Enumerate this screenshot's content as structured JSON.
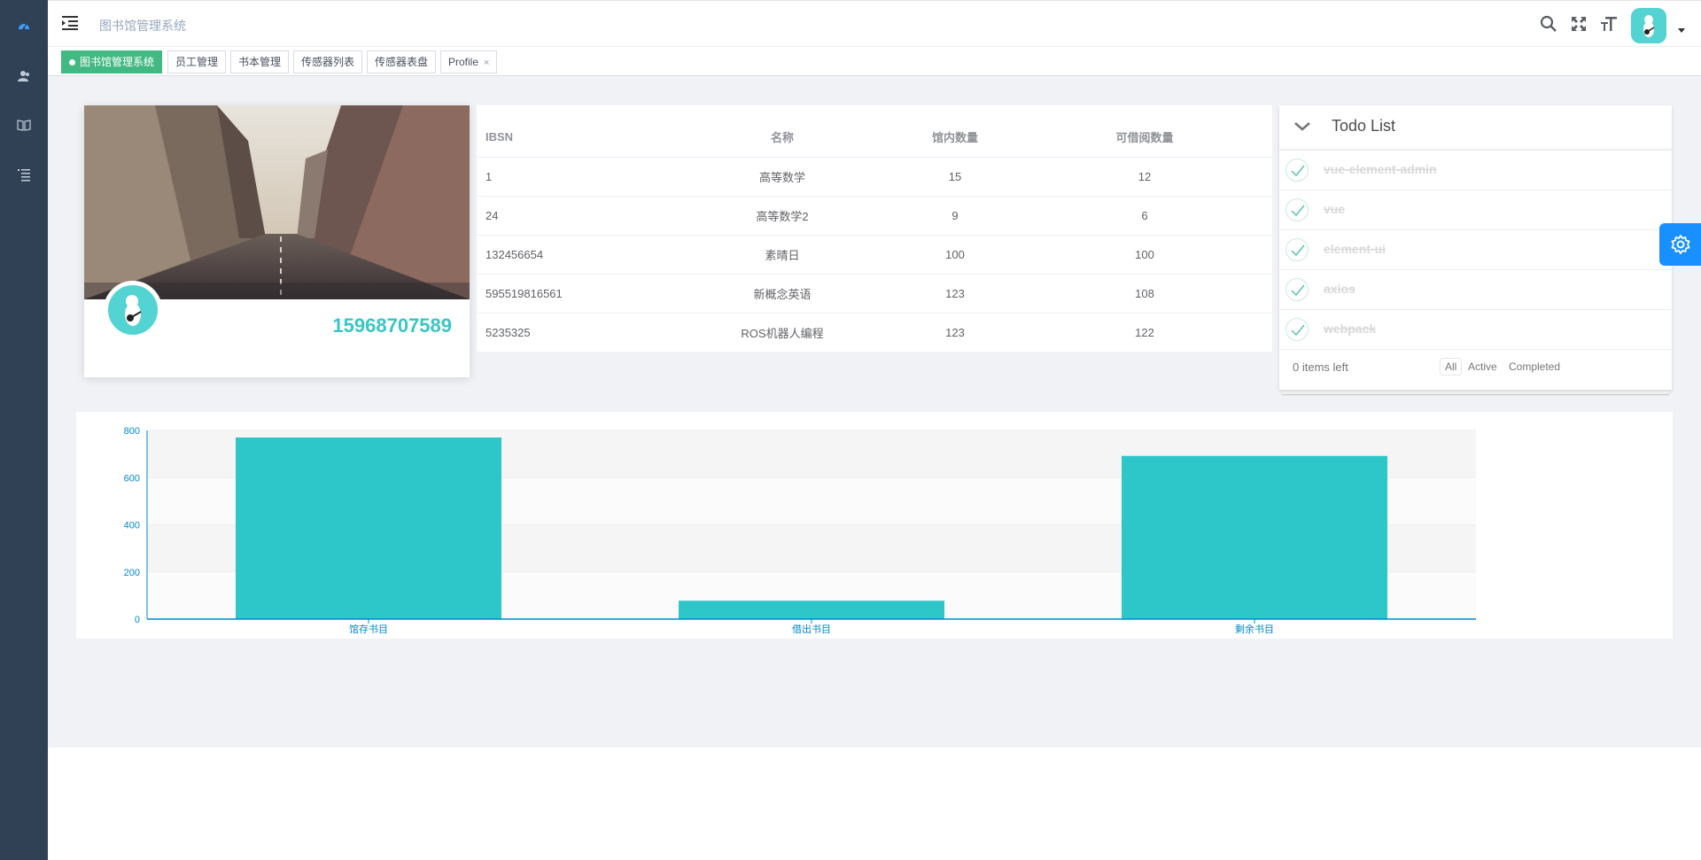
{
  "navbar": {
    "breadcrumb": "图书馆管理系统"
  },
  "tags": [
    {
      "label": "图书馆管理系统",
      "active": true
    },
    {
      "label": "员工管理",
      "active": false
    },
    {
      "label": "书本管理",
      "active": false
    },
    {
      "label": "传感器列表",
      "active": false
    },
    {
      "label": "传感器表盘",
      "active": false
    },
    {
      "label": "Profile",
      "active": false,
      "close": "×"
    }
  ],
  "profile": {
    "phone": "15968707589"
  },
  "book_table": {
    "headers": [
      "IBSN",
      "名称",
      "馆内数量",
      "可借阅数量"
    ],
    "rows": [
      [
        "1",
        "高等数学",
        "15",
        "12"
      ],
      [
        "24",
        "高等数学2",
        "9",
        "6"
      ],
      [
        "132456654",
        "素晴日",
        "100",
        "100"
      ],
      [
        "595519816561",
        "新概念英语",
        "123",
        "108"
      ],
      [
        "5235325",
        "ROS机器人编程",
        "123",
        "122"
      ]
    ]
  },
  "todo": {
    "title": "Todo List",
    "items": [
      "vue-element-admin",
      "vue",
      "element-ui",
      "axios",
      "webpack"
    ],
    "items_left": "0 items left",
    "filters": [
      "All",
      "Active",
      "Completed"
    ],
    "selected_filter": "All"
  },
  "chart_data": {
    "type": "bar",
    "categories": [
      "馆存书目",
      "借出书目",
      "剩余书目"
    ],
    "values": [
      770,
      78,
      692
    ],
    "ylim": [
      0,
      800
    ],
    "yticks": [
      0,
      200,
      400,
      600,
      800
    ],
    "grid": true,
    "colors": {
      "bar": "#2ec7c9",
      "axis": "#008acd"
    }
  },
  "colors": {
    "sidebar": "#304156",
    "tag_active": "#42b983",
    "accent": "#3bc5c5",
    "settings": "#1890ff"
  }
}
